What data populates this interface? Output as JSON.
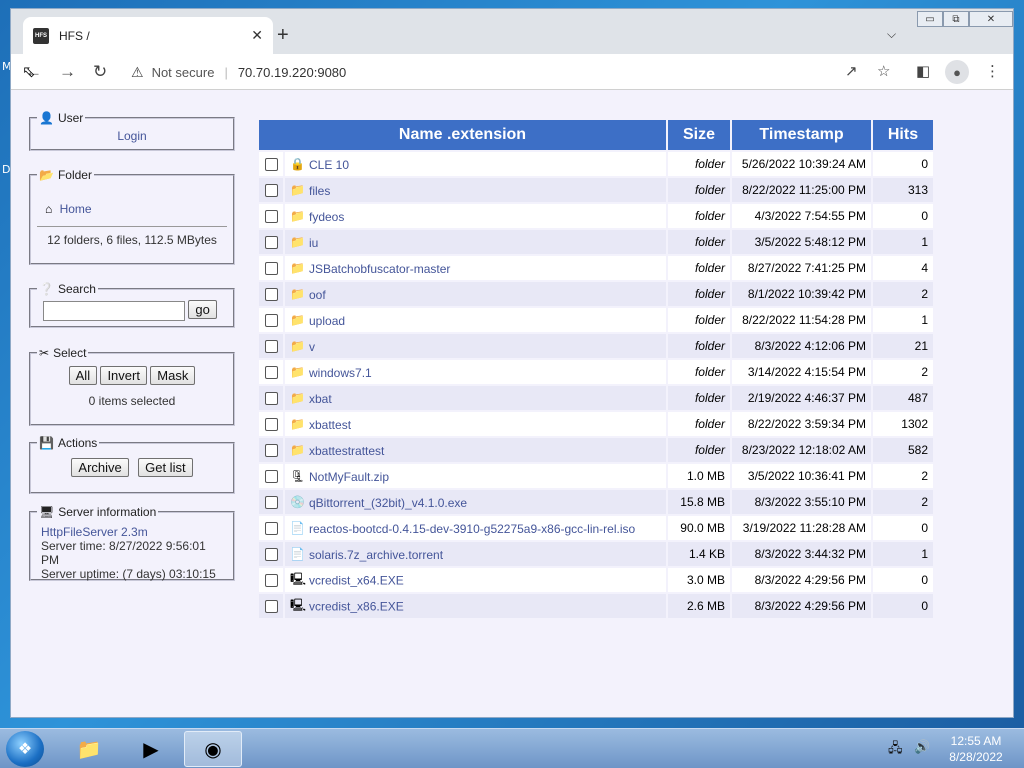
{
  "window": {
    "tab_title": "HFS /",
    "favicon_text": "HFS",
    "new_tab": "+",
    "tab_close": "✕",
    "minimize": "▭",
    "maximize": "⧉",
    "close": "✕"
  },
  "toolbar": {
    "not_secure": "Not secure",
    "url": "70.70.19.220:9080"
  },
  "desktop": {
    "label_m": "M",
    "label_d": "D"
  },
  "user": {
    "legend": "User",
    "login": "Login"
  },
  "folder": {
    "legend": "Folder",
    "home": "Home",
    "summary": "12 folders, 6 files, 112.5 MBytes"
  },
  "search": {
    "legend": "Search",
    "value": "",
    "go": "go"
  },
  "select": {
    "legend": "Select",
    "all": "All",
    "invert": "Invert",
    "mask": "Mask",
    "status": "0 items selected"
  },
  "actions": {
    "legend": "Actions",
    "archive": "Archive",
    "get_list": "Get list"
  },
  "server": {
    "legend": "Server information",
    "name": "HttpFileServer 2.3m",
    "time": "Server time: 8/27/2022 9:56:01 PM",
    "uptime": "Server uptime: (7 days) 03:10:15"
  },
  "table": {
    "headers": {
      "name": "Name .extension",
      "size": "Size",
      "timestamp": "Timestamp",
      "hits": "Hits"
    },
    "rows": [
      {
        "name": "CLE 10",
        "size": "folder",
        "time": "5/26/2022 10:39:24 AM",
        "hits": "0",
        "icon": "locked-folder-icon"
      },
      {
        "name": "files",
        "size": "folder",
        "time": "8/22/2022 11:25:00 PM",
        "hits": "313",
        "icon": "folder-icon"
      },
      {
        "name": "fydeos",
        "size": "folder",
        "time": "4/3/2022 7:54:55 PM",
        "hits": "0",
        "icon": "folder-icon"
      },
      {
        "name": "iu",
        "size": "folder",
        "time": "3/5/2022 5:48:12 PM",
        "hits": "1",
        "icon": "folder-icon"
      },
      {
        "name": "JSBatchobfuscator-master",
        "size": "folder",
        "time": "8/27/2022 7:41:25 PM",
        "hits": "4",
        "icon": "folder-icon"
      },
      {
        "name": "oof",
        "size": "folder",
        "time": "8/1/2022 10:39:42 PM",
        "hits": "2",
        "icon": "folder-icon"
      },
      {
        "name": "upload",
        "size": "folder",
        "time": "8/22/2022 11:54:28 PM",
        "hits": "1",
        "icon": "folder-icon"
      },
      {
        "name": "v",
        "size": "folder",
        "time": "8/3/2022 4:12:06 PM",
        "hits": "21",
        "icon": "folder-icon"
      },
      {
        "name": "windows7.1",
        "size": "folder",
        "time": "3/14/2022 4:15:54 PM",
        "hits": "2",
        "icon": "folder-icon"
      },
      {
        "name": "xbat",
        "size": "folder",
        "time": "2/19/2022 4:46:37 PM",
        "hits": "487",
        "icon": "folder-icon"
      },
      {
        "name": "xbattest",
        "size": "folder",
        "time": "8/22/2022 3:59:34 PM",
        "hits": "1302",
        "icon": "folder-icon"
      },
      {
        "name": "xbattestrattest",
        "size": "folder",
        "time": "8/23/2022 12:18:02 AM",
        "hits": "582",
        "icon": "folder-icon"
      },
      {
        "name": "NotMyFault.zip",
        "size": "1.0 MB",
        "time": "3/5/2022 10:36:41 PM",
        "hits": "2",
        "icon": "zip-icon"
      },
      {
        "name": "qBittorrent_(32bit)_v4.1.0.exe",
        "size": "15.8 MB",
        "time": "8/3/2022 3:55:10 PM",
        "hits": "2",
        "icon": "installer-icon"
      },
      {
        "name": "reactos-bootcd-0.4.15-dev-3910-g52275a9-x86-gcc-lin-rel.iso",
        "size": "90.0 MB",
        "time": "3/19/2022 11:28:28 AM",
        "hits": "0",
        "icon": "disc-image-icon"
      },
      {
        "name": "solaris.7z_archive.torrent",
        "size": "1.4 KB",
        "time": "8/3/2022 3:44:32 PM",
        "hits": "1",
        "icon": "file-icon"
      },
      {
        "name": "vcredist_x64.EXE",
        "size": "3.0 MB",
        "time": "8/3/2022 4:29:56 PM",
        "hits": "0",
        "icon": "exe-icon"
      },
      {
        "name": "vcredist_x86.EXE",
        "size": "2.6 MB",
        "time": "8/3/2022 4:29:56 PM",
        "hits": "0",
        "icon": "exe-icon"
      }
    ]
  },
  "taskbar": {
    "time": "12:55 AM",
    "date": "8/28/2022"
  }
}
